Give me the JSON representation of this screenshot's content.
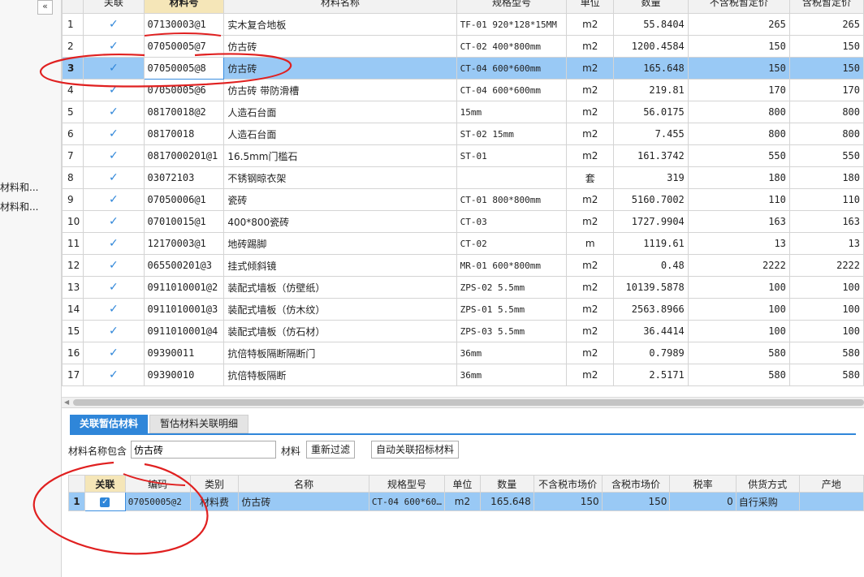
{
  "left_panel": {
    "collapse_icon": "double-chevron-left-icon",
    "items": [
      "材料和...",
      "材料和..."
    ]
  },
  "top_table": {
    "headers": [
      "",
      "关联",
      "材料号",
      "材料名称",
      "规格型号",
      "单位",
      "数量",
      "不含税暂定价",
      "含税暂定价"
    ],
    "rows": [
      {
        "n": "1",
        "code": "07130003@1",
        "name": "实木复合地板",
        "spec": "TF-01 920*128*15MM",
        "unit": "m2",
        "qty": "55.8404",
        "price": "265",
        "tax_price": "265"
      },
      {
        "n": "2",
        "code": "07050005@7",
        "name": "仿古砖",
        "spec": "CT-02 400*800mm",
        "unit": "m2",
        "qty": "1200.4584",
        "price": "150",
        "tax_price": "150"
      },
      {
        "n": "3",
        "code": "07050005@8",
        "name": "仿古砖",
        "spec": "CT-04 600*600mm",
        "unit": "m2",
        "qty": "165.648",
        "price": "150",
        "tax_price": "150"
      },
      {
        "n": "4",
        "code": "07050005@6",
        "name": "仿古砖 带防滑槽",
        "spec": "CT-04 600*600mm",
        "unit": "m2",
        "qty": "219.81",
        "price": "170",
        "tax_price": "170"
      },
      {
        "n": "5",
        "code": "08170018@2",
        "name": "人造石台面",
        "spec": "15mm",
        "unit": "m2",
        "qty": "56.0175",
        "price": "800",
        "tax_price": "800"
      },
      {
        "n": "6",
        "code": "08170018",
        "name": "人造石台面",
        "spec": "ST-02 15mm",
        "unit": "m2",
        "qty": "7.455",
        "price": "800",
        "tax_price": "800"
      },
      {
        "n": "7",
        "code": "0817000201@1",
        "name": "16.5mm门槛石",
        "spec": "ST-01",
        "unit": "m2",
        "qty": "161.3742",
        "price": "550",
        "tax_price": "550"
      },
      {
        "n": "8",
        "code": "03072103",
        "name": "不锈钢晾衣架",
        "spec": "",
        "unit": "套",
        "qty": "319",
        "price": "180",
        "tax_price": "180"
      },
      {
        "n": "9",
        "code": "07050006@1",
        "name": "瓷砖",
        "spec": "CT-01 800*800mm",
        "unit": "m2",
        "qty": "5160.7002",
        "price": "110",
        "tax_price": "110"
      },
      {
        "n": "10",
        "code": "07010015@1",
        "name": "400*800瓷砖",
        "spec": "CT-03",
        "unit": "m2",
        "qty": "1727.9904",
        "price": "163",
        "tax_price": "163"
      },
      {
        "n": "11",
        "code": "12170003@1",
        "name": "地砖踢脚",
        "spec": "CT-02",
        "unit": "m",
        "qty": "1119.61",
        "price": "13",
        "tax_price": "13"
      },
      {
        "n": "12",
        "code": "065500201@3",
        "name": "挂式倾斜镜",
        "spec": "MR-01 600*800mm",
        "unit": "m2",
        "qty": "0.48",
        "price": "2222",
        "tax_price": "2222"
      },
      {
        "n": "13",
        "code": "0911010001@2",
        "name": "装配式墙板（仿壁纸）",
        "spec": "ZPS-02 5.5mm",
        "unit": "m2",
        "qty": "10139.5878",
        "price": "100",
        "tax_price": "100"
      },
      {
        "n": "14",
        "code": "0911010001@3",
        "name": "装配式墙板（仿木纹）",
        "spec": "ZPS-01 5.5mm",
        "unit": "m2",
        "qty": "2563.8966",
        "price": "100",
        "tax_price": "100"
      },
      {
        "n": "15",
        "code": "0911010001@4",
        "name": "装配式墙板（仿石材）",
        "spec": "ZPS-03 5.5mm",
        "unit": "m2",
        "qty": "36.4414",
        "price": "100",
        "tax_price": "100"
      },
      {
        "n": "16",
        "code": "09390011",
        "name": "抗倍特板隔断隔断门",
        "spec": "36mm",
        "unit": "m2",
        "qty": "0.7989",
        "price": "580",
        "tax_price": "580"
      },
      {
        "n": "17",
        "code": "09390010",
        "name": "抗倍特板隔断",
        "spec": "36mm",
        "unit": "m2",
        "qty": "2.5171",
        "price": "580",
        "tax_price": "580"
      }
    ],
    "selected_row": "3",
    "check_glyph": "✓"
  },
  "lower": {
    "tabs": [
      "关联暂估材料",
      "暂估材料关联明细"
    ],
    "filter_label": "材料名称包含",
    "filter_value": "仿古砖",
    "filter_label2": "材料",
    "refilter_button": "重新过滤",
    "auto_link_button": "自动关联招标材料",
    "headers": [
      "",
      "关联",
      "编码",
      "类别",
      "名称",
      "规格型号",
      "单位",
      "数量",
      "不含税市场价",
      "含税市场价",
      "税率",
      "供货方式",
      "产地"
    ],
    "row": {
      "n": "1",
      "code": "07050005@2",
      "category": "材料费",
      "name": "仿古砖",
      "spec": "CT-04 600*60…",
      "unit": "m2",
      "qty": "165.648",
      "price": "150",
      "tax_price": "150",
      "tax_rate": "0",
      "supply": "自行采购",
      "origin": ""
    }
  },
  "annotation_color": "#e02020"
}
